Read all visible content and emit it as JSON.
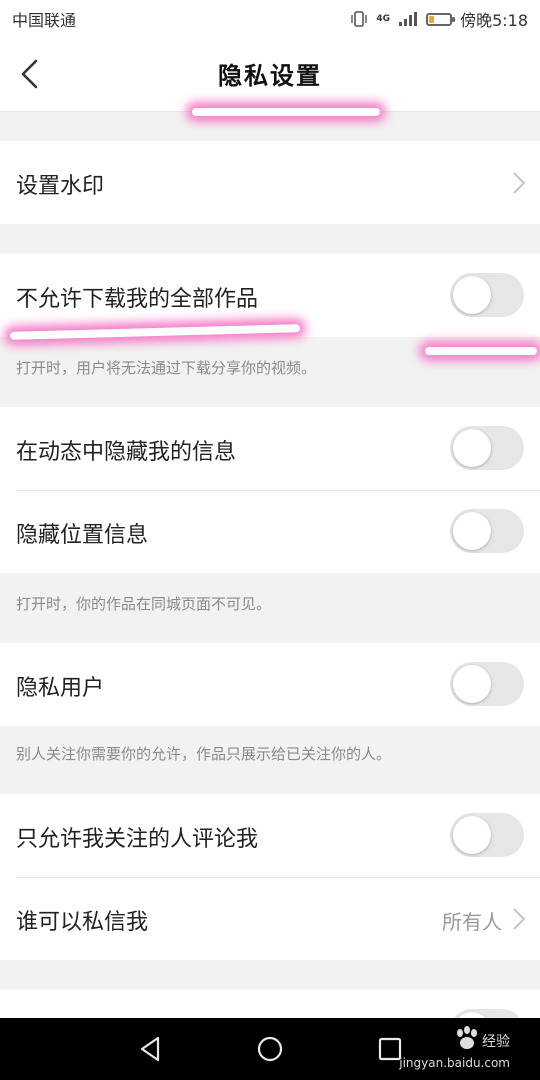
{
  "status_bar": {
    "carrier": "中国联通",
    "network": "4G",
    "time": "傍晚5:18",
    "battery_level": 0.3
  },
  "header": {
    "title": "隐私设置",
    "back_icon": "chevron-left-icon"
  },
  "settings": [
    {
      "label": "设置水印",
      "type": "link"
    },
    {
      "label": "不允许下载我的全部作品",
      "type": "toggle",
      "on": false
    },
    {
      "label": "在动态中隐藏我的信息",
      "type": "toggle",
      "on": false
    },
    {
      "label": "隐藏位置信息",
      "type": "toggle",
      "on": false
    },
    {
      "label": "隐私用户",
      "type": "toggle",
      "on": false
    },
    {
      "label": "只允许我关注的人评论我",
      "type": "toggle",
      "on": false
    },
    {
      "label": "谁可以私信我",
      "type": "link",
      "value": "所有人"
    }
  ],
  "descriptions": {
    "download": "打开时，用户将无法通过下载分享你的视频。",
    "location": "打开时，你的作品在同城页面不可见。",
    "private_user": "别人关注你需要你的允许，作品只展示给已关注你的人。"
  },
  "nav": {
    "back_icon": "triangle-back-icon",
    "home_icon": "circle-home-icon",
    "recent_icon": "square-recent-icon"
  },
  "watermark": {
    "text": "jingyan.baidu.com",
    "logo_text": "经验"
  },
  "colors": {
    "toggle_off": "#e6e6e6",
    "highlight": "#f47cc9",
    "battery": "#f5a623"
  }
}
